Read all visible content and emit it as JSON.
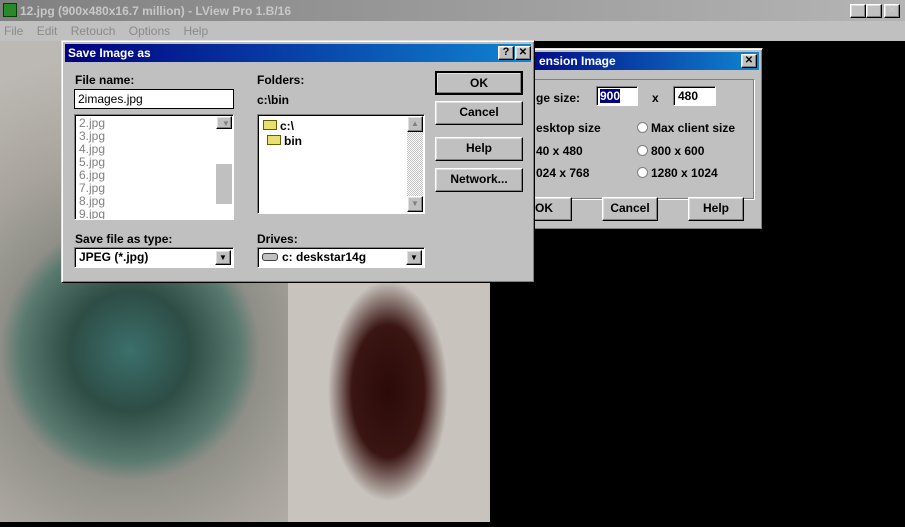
{
  "main_window": {
    "title": "12.jpg (900x480x16.7 million) - LView Pro 1.B/16",
    "menu": [
      "File",
      "Edit",
      "Retouch",
      "Options",
      "Help"
    ]
  },
  "save_dialog": {
    "title": "Save Image as",
    "file_name_label": "File name:",
    "file_name_value": "2images.jpg",
    "files": [
      "2.jpg",
      "3.jpg",
      "4.jpg",
      "5.jpg",
      "6.jpg",
      "7.jpg",
      "8.jpg",
      "9.jpg"
    ],
    "folders_label": "Folders:",
    "current_path": "c:\\bin",
    "folders": [
      "c:\\",
      "bin"
    ],
    "type_label": "Save file as type:",
    "type_value": "JPEG (*.jpg)",
    "drives_label": "Drives:",
    "drive_value": "c: deskstar14g",
    "ok": "OK",
    "cancel": "Cancel",
    "help": "Help",
    "network": "Network..."
  },
  "dimension_dialog": {
    "title": "ension Image",
    "size_label": "ge size:",
    "width": "900",
    "x_label": "x",
    "height": "480",
    "options": [
      "esktop size",
      "Max client size",
      "40 x 480",
      "800 x 600",
      "024 x 768",
      "1280 x 1024"
    ],
    "ok": "OK",
    "cancel": "Cancel",
    "help": "Help"
  }
}
